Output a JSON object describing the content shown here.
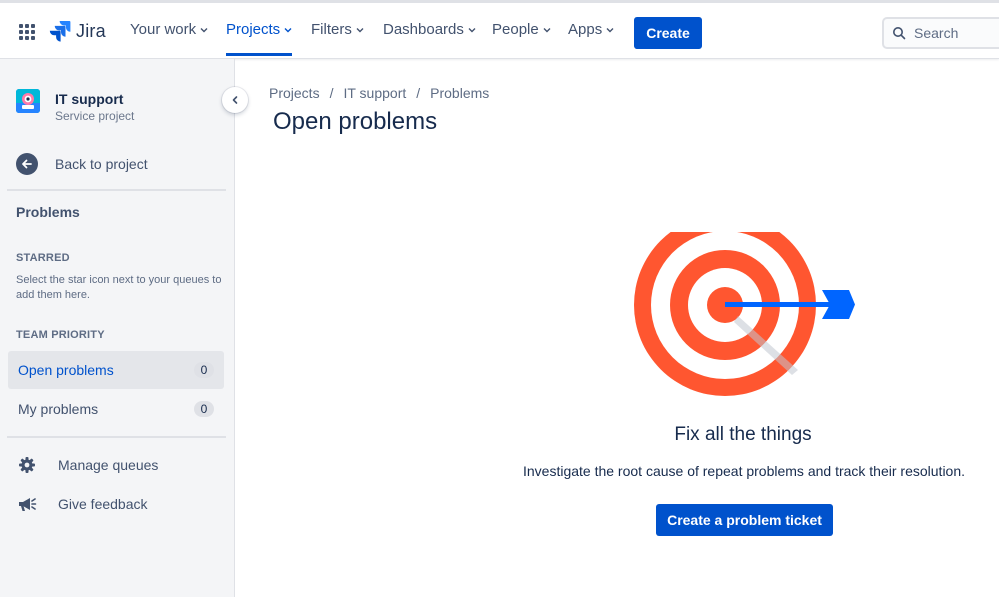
{
  "topnav": {
    "logo_text": "Jira",
    "items": [
      {
        "label": "Your work"
      },
      {
        "label": "Projects"
      },
      {
        "label": "Filters"
      },
      {
        "label": "Dashboards"
      },
      {
        "label": "People"
      },
      {
        "label": "Apps"
      }
    ],
    "create_label": "Create",
    "search_placeholder": "Search"
  },
  "sidebar": {
    "project_name": "IT support",
    "project_type": "Service project",
    "back_label": "Back to project",
    "section_title": "Problems",
    "starred_title": "STARRED",
    "starred_help": "Select the star icon next to your queues to add them here.",
    "team_priority_title": "TEAM PRIORITY",
    "queues": [
      {
        "label": "Open problems",
        "count": "0"
      },
      {
        "label": "My problems",
        "count": "0"
      }
    ],
    "manage_queues": "Manage queues",
    "give_feedback": "Give feedback"
  },
  "main": {
    "breadcrumbs": [
      "Projects",
      "IT support",
      "Problems"
    ],
    "page_title": "Open problems",
    "empty_title": "Fix all the things",
    "empty_description": "Investigate the root cause of repeat problems and track their resolution.",
    "cta_label": "Create a problem ticket"
  },
  "colors": {
    "brand": "#0052cc",
    "target_red": "#ff5630",
    "arrow_blue": "#0065ff"
  }
}
